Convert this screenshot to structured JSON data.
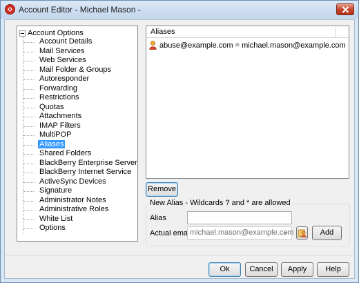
{
  "window": {
    "title": "Account Editor - Michael Mason -"
  },
  "tree": {
    "root_label": "Account Options",
    "items": [
      {
        "label": "Account Details"
      },
      {
        "label": "Mail Services"
      },
      {
        "label": "Web Services"
      },
      {
        "label": "Mail Folder & Groups"
      },
      {
        "label": "Autoresponder"
      },
      {
        "label": "Forwarding"
      },
      {
        "label": "Restrictions"
      },
      {
        "label": "Quotas"
      },
      {
        "label": "Attachments"
      },
      {
        "label": "IMAP Filters"
      },
      {
        "label": "MultiPOP"
      },
      {
        "label": "Aliases",
        "selected": true
      },
      {
        "label": "Shared Folders"
      },
      {
        "label": "BlackBerry Enterprise Server"
      },
      {
        "label": "BlackBerry Internet Service"
      },
      {
        "label": "ActiveSync Devices"
      },
      {
        "label": "Signature"
      },
      {
        "label": "Administrator Notes"
      },
      {
        "label": "Administrative Roles"
      },
      {
        "label": "White List"
      },
      {
        "label": "Options"
      }
    ]
  },
  "aliases": {
    "header": "Aliases",
    "rows": [
      {
        "text": "abuse@example.com = michael.mason@example.com",
        "icon": "user-icon"
      }
    ]
  },
  "buttons": {
    "remove": "Remove",
    "add": "Add",
    "ok": "Ok",
    "cancel": "Cancel",
    "apply": "Apply",
    "help": "Help"
  },
  "new_alias": {
    "group_title": "New Alias - Wildcards ? and * are allowed",
    "alias_label": "Alias",
    "alias_value": "",
    "actual_email_label": "Actual email",
    "actual_email_value": "michael.mason@example.com"
  }
}
